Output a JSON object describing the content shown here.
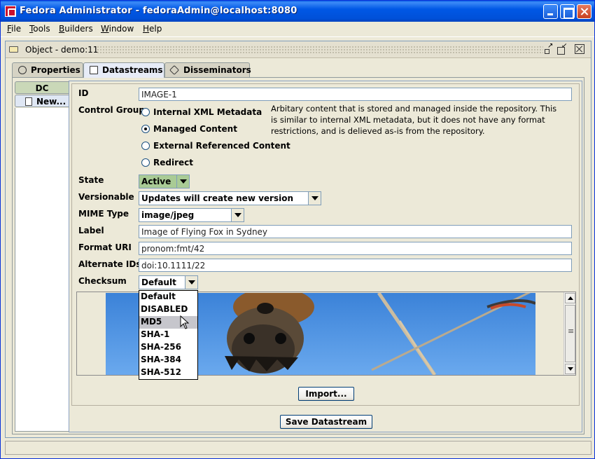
{
  "window": {
    "title": "Fedora Administrator - fedoraAdmin@localhost:8080"
  },
  "menu": [
    {
      "key": "F",
      "rest": "ile"
    },
    {
      "key": "T",
      "rest": "ools"
    },
    {
      "key": "B",
      "rest": "uilders"
    },
    {
      "key": "W",
      "rest": "indow"
    },
    {
      "key": "H",
      "rest": "elp"
    }
  ],
  "object_frame": {
    "title": "Object - demo:11"
  },
  "tabs": [
    "Properties",
    "Datastreams",
    "Disseminators"
  ],
  "side_tabs": [
    "DC",
    "New..."
  ],
  "form": {
    "id_label": "ID",
    "id_value": "IMAGE-1",
    "control_group_label": "Control Group",
    "control_group_options": [
      "Internal XML Metadata",
      "Managed Content",
      "External Referenced Content",
      "Redirect"
    ],
    "control_group_selected": "Managed Content",
    "control_group_description": "Arbitary content that is stored and managed inside the repository.  This is similar to internal XML metadata, but it does not have any format restrictions, and is delieved as-is from the repository.",
    "state_label": "State",
    "state_value": "Active",
    "versionable_label": "Versionable",
    "versionable_value": "Updates will create new version",
    "mime_label": "MIME Type",
    "mime_value": "image/jpeg",
    "label_label": "Label",
    "label_value": "Image of Flying Fox in Sydney",
    "format_uri_label": "Format URI",
    "format_uri_value": "pronom:fmt/42",
    "alt_ids_label": "Alternate IDs",
    "alt_ids_value": "doi:10.1111/22",
    "checksum_label": "Checksum",
    "checksum_value": "Default",
    "checksum_options": [
      "Default",
      "DISABLED",
      "MD5",
      "SHA-1",
      "SHA-256",
      "SHA-384",
      "SHA-512"
    ],
    "checksum_highlighted": "MD5"
  },
  "buttons": {
    "import": "Import...",
    "save": "Save Datastream"
  },
  "colors": {
    "title_blue": "#0058e6",
    "state_green": "#a9cb95",
    "sky": "#3f8ee0"
  }
}
